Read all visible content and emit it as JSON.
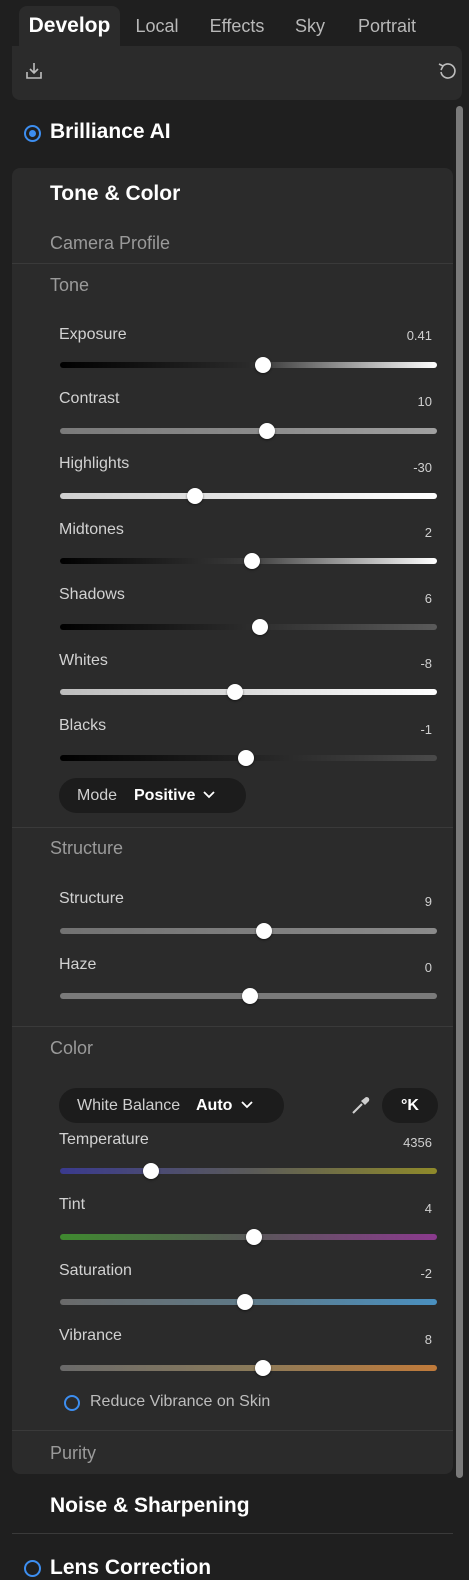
{
  "tabs": [
    "Develop",
    "Local",
    "Effects",
    "Sky",
    "Portrait"
  ],
  "sections": {
    "brilliance": "Brilliance AI",
    "tone_color": "Tone & Color",
    "noise": "Noise & Sharpening",
    "lens": "Lens Correction"
  },
  "subsections": {
    "camera_profile": "Camera Profile",
    "tone": "Tone",
    "structure": "Structure",
    "color": "Color",
    "purity": "Purity"
  },
  "sliders": [
    {
      "label": "Exposure",
      "value": "0.41"
    },
    {
      "label": "Contrast",
      "value": "10"
    },
    {
      "label": "Highlights",
      "value": "-30"
    },
    {
      "label": "Midtones",
      "value": "2"
    },
    {
      "label": "Shadows",
      "value": "6"
    },
    {
      "label": "Whites",
      "value": "-8"
    },
    {
      "label": "Blacks",
      "value": "-1"
    },
    {
      "label": "Structure",
      "value": "9"
    },
    {
      "label": "Haze",
      "value": "0"
    },
    {
      "label": "Temperature",
      "value": "4356"
    },
    {
      "label": "Tint",
      "value": "4"
    },
    {
      "label": "Saturation",
      "value": "-2"
    },
    {
      "label": "Vibrance",
      "value": "8"
    }
  ],
  "mode": {
    "label": "Mode",
    "value": "Positive"
  },
  "white_balance": {
    "label": "White Balance",
    "value": "Auto",
    "kelvin_button": "°K"
  },
  "reduce_vibrance": "Reduce Vibrance on Skin",
  "colors": {
    "accent": "#3d8ef0",
    "panel": "#2b2b2b",
    "background": "#1f1f1f"
  },
  "icons": [
    "export-icon",
    "undo-icon",
    "eyedropper-icon",
    "chevron-down-icon"
  ]
}
